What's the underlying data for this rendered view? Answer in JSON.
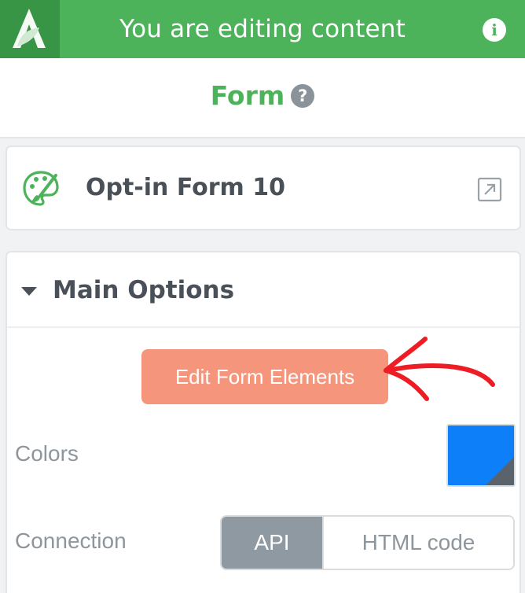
{
  "topbar": {
    "title": "You are editing content",
    "logo_icon": "leaf-logo-icon",
    "info_icon": "info-icon",
    "accent_color": "#4db35a"
  },
  "header": {
    "title": "Form",
    "help_icon": "question-mark-icon"
  },
  "form_card": {
    "icon": "palette-icon",
    "title": "Opt-in Form 10",
    "action_icon": "external-link-icon"
  },
  "main_options": {
    "section_title": "Main Options",
    "edit_button_label": "Edit Form Elements",
    "edit_button_color": "#f5967c",
    "colors_label": "Colors",
    "color_value": "#0d80f9",
    "connection_label": "Connection",
    "connection_options": [
      "API",
      "HTML code"
    ],
    "connection_selected": "API"
  }
}
